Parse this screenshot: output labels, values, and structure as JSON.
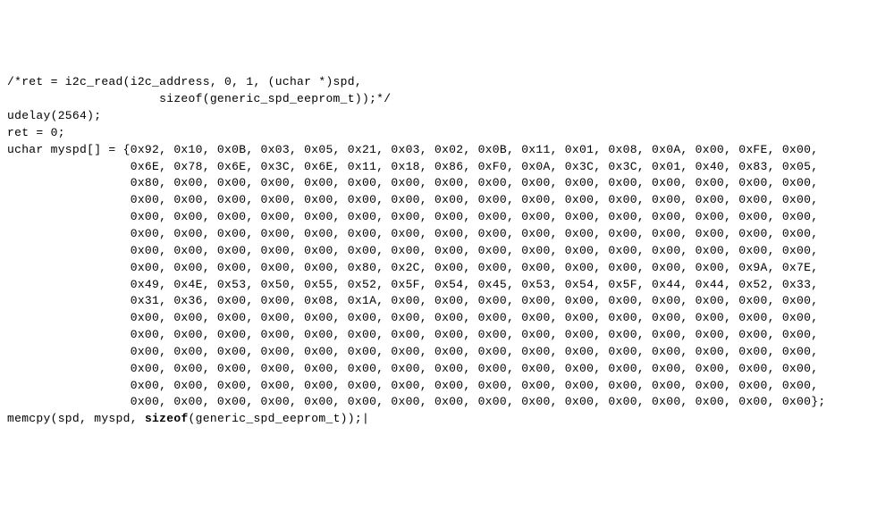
{
  "lines": [
    "/*ret = i2c_read(i2c_address, 0, 1, (uchar *)spd,",
    "                     sizeof(generic_spd_eeprom_t));*/",
    "udelay(2564);",
    "ret = 0;",
    "uchar myspd[] = {0x92, 0x10, 0x0B, 0x03, 0x05, 0x21, 0x03, 0x02, 0x0B, 0x11, 0x01, 0x08, 0x0A, 0x00, 0xFE, 0x00,",
    "                 0x6E, 0x78, 0x6E, 0x3C, 0x6E, 0x11, 0x18, 0x86, 0xF0, 0x0A, 0x3C, 0x3C, 0x01, 0x40, 0x83, 0x05,",
    "                 0x80, 0x00, 0x00, 0x00, 0x00, 0x00, 0x00, 0x00, 0x00, 0x00, 0x00, 0x00, 0x00, 0x00, 0x00, 0x00,",
    "                 0x00, 0x00, 0x00, 0x00, 0x00, 0x00, 0x00, 0x00, 0x00, 0x00, 0x00, 0x00, 0x00, 0x00, 0x00, 0x00,",
    "                 0x00, 0x00, 0x00, 0x00, 0x00, 0x00, 0x00, 0x00, 0x00, 0x00, 0x00, 0x00, 0x00, 0x00, 0x00, 0x00,",
    "                 0x00, 0x00, 0x00, 0x00, 0x00, 0x00, 0x00, 0x00, 0x00, 0x00, 0x00, 0x00, 0x00, 0x00, 0x00, 0x00,",
    "                 0x00, 0x00, 0x00, 0x00, 0x00, 0x00, 0x00, 0x00, 0x00, 0x00, 0x00, 0x00, 0x00, 0x00, 0x00, 0x00,",
    "                 0x00, 0x00, 0x00, 0x00, 0x00, 0x80, 0x2C, 0x00, 0x00, 0x00, 0x00, 0x00, 0x00, 0x00, 0x9A, 0x7E,",
    "                 0x49, 0x4E, 0x53, 0x50, 0x55, 0x52, 0x5F, 0x54, 0x45, 0x53, 0x54, 0x5F, 0x44, 0x44, 0x52, 0x33,",
    "                 0x31, 0x36, 0x00, 0x00, 0x08, 0x1A, 0x00, 0x00, 0x00, 0x00, 0x00, 0x00, 0x00, 0x00, 0x00, 0x00,",
    "                 0x00, 0x00, 0x00, 0x00, 0x00, 0x00, 0x00, 0x00, 0x00, 0x00, 0x00, 0x00, 0x00, 0x00, 0x00, 0x00,",
    "                 0x00, 0x00, 0x00, 0x00, 0x00, 0x00, 0x00, 0x00, 0x00, 0x00, 0x00, 0x00, 0x00, 0x00, 0x00, 0x00,",
    "                 0x00, 0x00, 0x00, 0x00, 0x00, 0x00, 0x00, 0x00, 0x00, 0x00, 0x00, 0x00, 0x00, 0x00, 0x00, 0x00,",
    "                 0x00, 0x00, 0x00, 0x00, 0x00, 0x00, 0x00, 0x00, 0x00, 0x00, 0x00, 0x00, 0x00, 0x00, 0x00, 0x00,",
    "                 0x00, 0x00, 0x00, 0x00, 0x00, 0x00, 0x00, 0x00, 0x00, 0x00, 0x00, 0x00, 0x00, 0x00, 0x00, 0x00,",
    "                 0x00, 0x00, 0x00, 0x00, 0x00, 0x00, 0x00, 0x00, 0x00, 0x00, 0x00, 0x00, 0x00, 0x00, 0x00, 0x00};"
  ],
  "last_line_prefix": "memcpy(spd, myspd, ",
  "last_line_bold": "sizeof",
  "last_line_suffix": "(generic_spd_eeprom_t));|"
}
